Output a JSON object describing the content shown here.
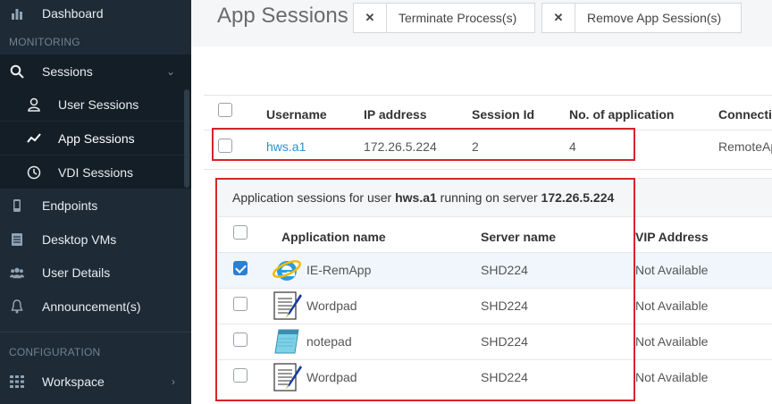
{
  "sidebar": {
    "dashboard": "Dashboard",
    "section_monitoring": "MONITORING",
    "sessions": "Sessions",
    "user_sessions": "User Sessions",
    "app_sessions": "App Sessions",
    "vdi_sessions": "VDI Sessions",
    "endpoints": "Endpoints",
    "desktop_vms": "Desktop VMs",
    "user_details": "User Details",
    "announcements": "Announcement(s)",
    "section_configuration": "CONFIGURATION",
    "workspace": "Workspace"
  },
  "page": {
    "title": "App Sessions",
    "terminate_button": "Terminate Process(s)",
    "remove_button": "Remove App Session(s)"
  },
  "sessions_table": {
    "columns": [
      "Username",
      "IP address",
      "Session Id",
      "No. of application",
      "Connectio"
    ],
    "row": {
      "username": "hws.a1",
      "ip": "172.26.5.224",
      "session_id": "2",
      "apps": "4",
      "connection": "RemoteAp"
    }
  },
  "detail": {
    "prefix": "Application sessions for user ",
    "user": "hws.a1",
    "middle": " running on server ",
    "server": "172.26.5.224",
    "columns": [
      "Application name",
      "Server name",
      "VIP Address"
    ],
    "rows": [
      {
        "app": "IE-RemApp",
        "server": "SHD224",
        "vip": "Not Available",
        "icon": "ie-icon",
        "checked": true
      },
      {
        "app": "Wordpad",
        "server": "SHD224",
        "vip": "Not Available",
        "icon": "wordpad-icon",
        "checked": false
      },
      {
        "app": "notepad",
        "server": "SHD224",
        "vip": "Not Available",
        "icon": "notepad-icon",
        "checked": false
      },
      {
        "app": "Wordpad",
        "server": "SHD224",
        "vip": "Not Available",
        "icon": "wordpad-icon",
        "checked": false
      }
    ]
  }
}
